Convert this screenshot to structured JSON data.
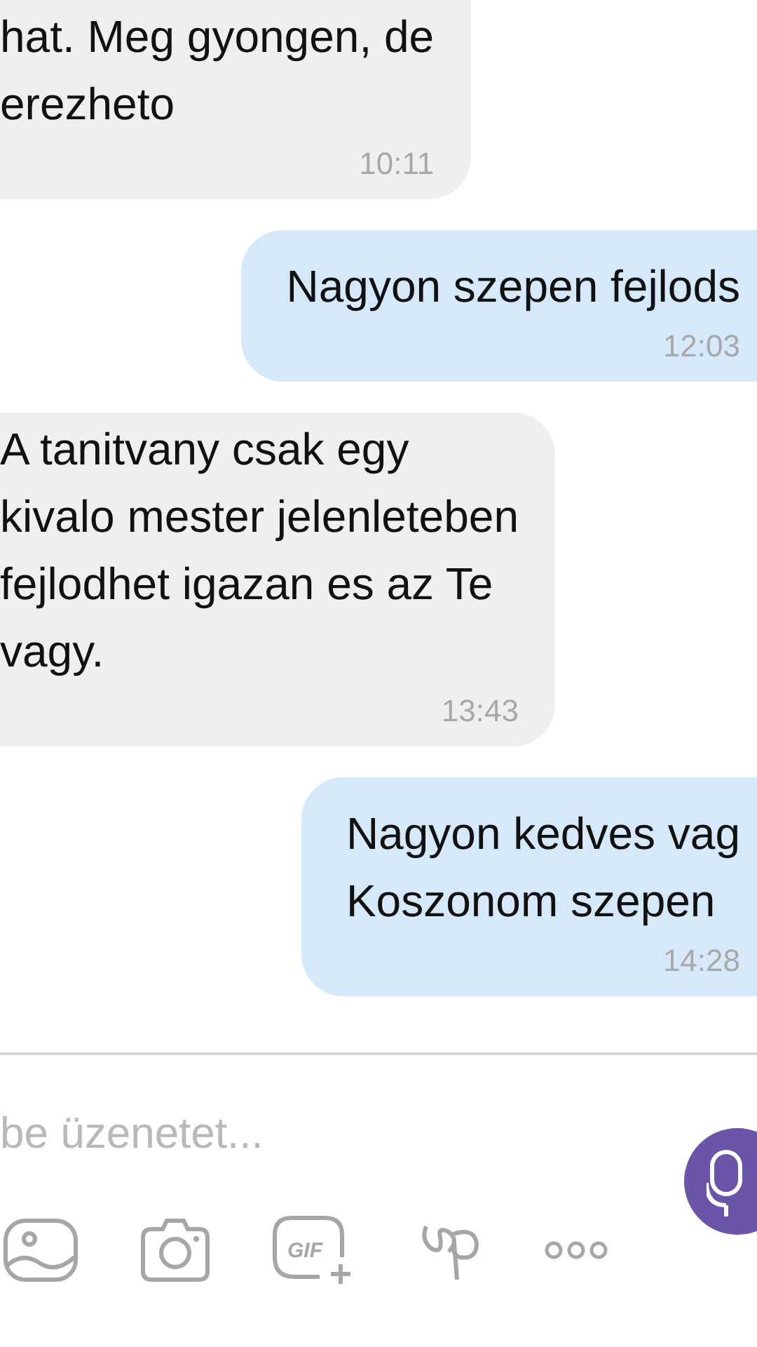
{
  "messages": [
    {
      "kind": "incoming",
      "lines": [
        "hat. Meg gyongen, de",
        "erezheto"
      ],
      "time": "10:11"
    },
    {
      "kind": "outgoing",
      "lines": [
        "Nagyon szepen fejlods"
      ],
      "time": "12:03"
    },
    {
      "kind": "incoming",
      "lines": [
        "A tanitvany csak egy",
        "kivalo mester jelenleteben",
        "fejlodhet igazan es az Te",
        "vagy."
      ],
      "time": "13:43"
    },
    {
      "kind": "outgoing",
      "lines": [
        "Nagyon kedves vag",
        "Koszonom szepen"
      ],
      "time": "14:28"
    }
  ],
  "composer": {
    "placeholder": "be üzenetet...",
    "gif_label": "GIF"
  }
}
